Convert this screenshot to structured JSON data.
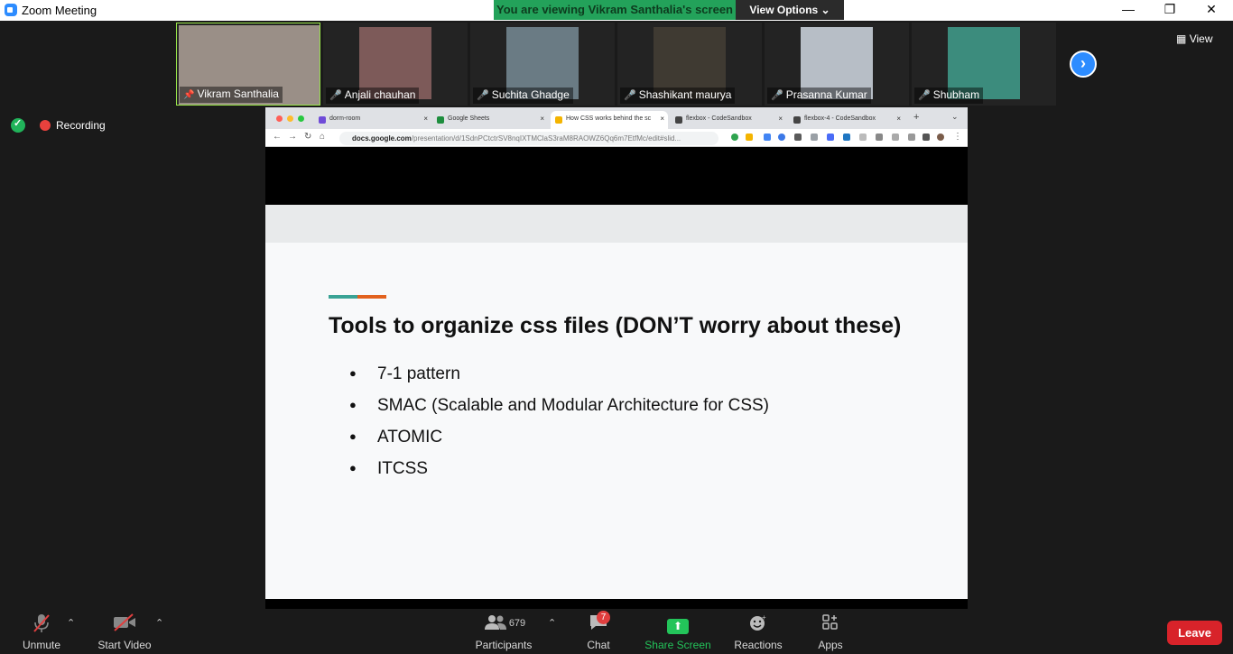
{
  "window": {
    "title": "Zoom Meeting"
  },
  "banner": {
    "viewing": "You are viewing Vikram Santhalia's screen",
    "options": "View Options ⌄"
  },
  "top_right": {
    "view_label": "View"
  },
  "participants_strip": [
    {
      "name": "Vikram Santhalia",
      "muted": false,
      "pinned": true,
      "color": "#9a8f87"
    },
    {
      "name": "Anjali chauhan",
      "muted": true,
      "color": "#7d5a59"
    },
    {
      "name": "Suchita Ghadge",
      "muted": true,
      "color": "#6a7b84"
    },
    {
      "name": "Shashikant maurya",
      "muted": true,
      "color": "#3f3a32"
    },
    {
      "name": "Prasanna Kumar",
      "muted": true,
      "color": "#b7bec6"
    },
    {
      "name": "Shubham",
      "muted": true,
      "color": "#3c8c7d"
    }
  ],
  "status": {
    "recording": "Recording"
  },
  "browser": {
    "tabs": [
      {
        "title": "dorm-room",
        "favicon_color": "#6f4bd8"
      },
      {
        "title": "Google Sheets",
        "favicon_color": "#1e8e3e"
      },
      {
        "title": "How CSS works behind the sc",
        "favicon_color": "#f4b400",
        "active": true
      },
      {
        "title": "flexbox - CodeSandbox",
        "favicon_color": "#444444"
      },
      {
        "title": "flexbox-4 - CodeSandbox",
        "favicon_color": "#444444"
      }
    ],
    "url_host": "docs.google.com",
    "url_path": "/presentation/d/1SdnPCtctrSV8nqIXTMClaS3raM8RAOWZ6Qq6m7EtfMc/edit#slid..."
  },
  "slide": {
    "title": "Tools to organize css files  (DON’T worry about these)",
    "bullets": [
      "7-1 pattern",
      "SMAC (Scalable and Modular Architecture for CSS)",
      "ATOMIC",
      "ITCSS"
    ]
  },
  "toolbar": {
    "unmute": "Unmute",
    "start_video": "Start Video",
    "participants": "Participants",
    "participant_count": "679",
    "chat": "Chat",
    "chat_badge": "7",
    "share_screen": "Share Screen",
    "reactions": "Reactions",
    "apps": "Apps",
    "leave": "Leave"
  }
}
